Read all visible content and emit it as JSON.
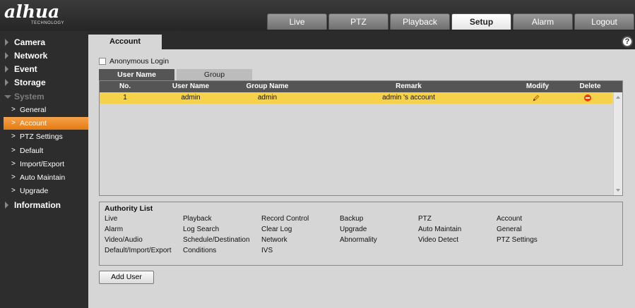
{
  "logo": {
    "brand": "alhua",
    "tagline": "TECHNOLOGY"
  },
  "nav": [
    "Live",
    "PTZ",
    "Playback",
    "Setup",
    "Alarm",
    "Logout"
  ],
  "sidebar": {
    "sections": [
      {
        "label": "Camera"
      },
      {
        "label": "Network"
      },
      {
        "label": "Event"
      },
      {
        "label": "Storage"
      },
      {
        "label": "System"
      }
    ],
    "system_items": [
      "General",
      "Account",
      "PTZ Settings",
      "Default",
      "Import/Export",
      "Auto Maintain",
      "Upgrade"
    ],
    "information": "Information"
  },
  "main": {
    "tab_title": "Account",
    "help": "?",
    "anonymous_login": "Anonymous Login",
    "subtabs": [
      "User Name",
      "Group"
    ],
    "table": {
      "headers": [
        "No.",
        "User Name",
        "Group Name",
        "Remark",
        "Modify",
        "Delete"
      ],
      "rows": [
        {
          "no": "1",
          "user": "admin",
          "group": "admin",
          "remark": "admin 's account"
        }
      ]
    },
    "authority": {
      "title": "Authority List",
      "items": [
        "Live",
        "Playback",
        "Record Control",
        "Backup",
        "PTZ",
        "Account",
        "Alarm",
        "Log Search",
        "Clear Log",
        "Upgrade",
        "Auto Maintain",
        "General",
        "Video/Audio",
        "Schedule/Destination",
        "Network",
        "Abnormality",
        "Video Detect",
        "PTZ Settings",
        "Default/Import/Export",
        "Conditions",
        "IVS"
      ]
    },
    "add_user": "Add User"
  },
  "colors": {
    "accent": "#e57b12",
    "row_highlight": "#f5d24a",
    "delete": "#e8420a"
  }
}
